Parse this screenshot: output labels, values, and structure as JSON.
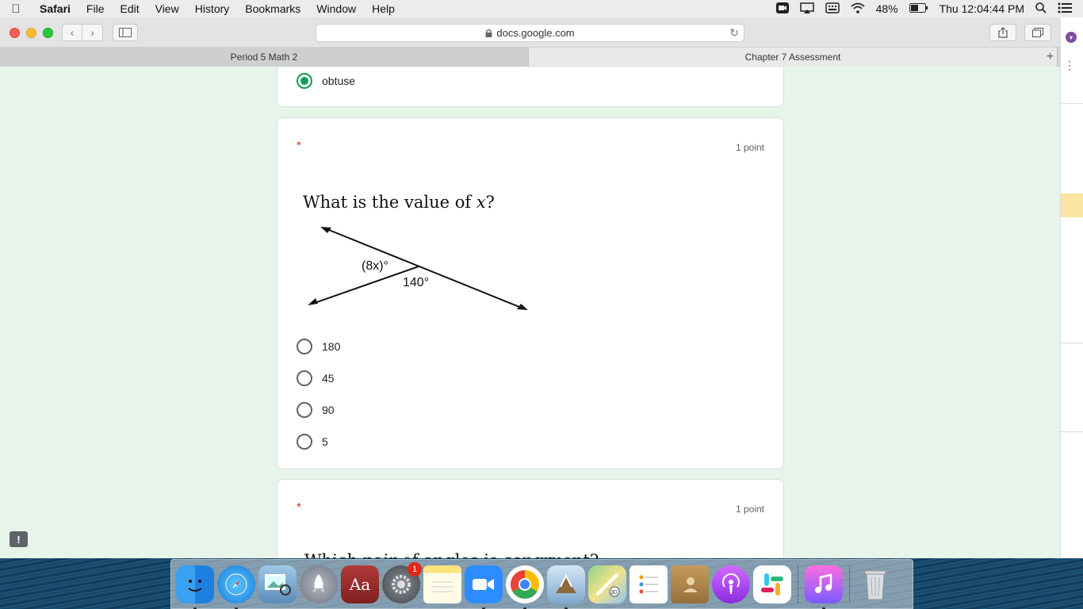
{
  "menubar": {
    "app": "Safari",
    "items": [
      "File",
      "Edit",
      "View",
      "History",
      "Bookmarks",
      "Window",
      "Help"
    ],
    "battery": "48%",
    "clock": "Thu 12:04:44 PM"
  },
  "browser": {
    "url": "docs.google.com",
    "tabs": [
      {
        "label": "Period 5 Math 2"
      },
      {
        "label": "Chapter 7 Assessment"
      }
    ]
  },
  "form": {
    "prev_option": "obtuse",
    "question": {
      "required": "*",
      "points": "1 point",
      "text": "What is the value of",
      "var": "x",
      "qmark": "?",
      "figure": {
        "angle_label_1": "(8x)°",
        "angle_label_2": "140°"
      },
      "options": [
        "180",
        "45",
        "90",
        "5"
      ]
    },
    "next_question": {
      "required": "*",
      "points": "1 point",
      "text_partial": "Which pair of angles is congruent?"
    }
  },
  "dock": {
    "items": [
      "finder",
      "safari",
      "preview",
      "launchpad",
      "dictionary",
      "system-preferences",
      "notes",
      "zoom",
      "chrome",
      "mail",
      "maps",
      "reminders",
      "contacts",
      "podcasts",
      "slack",
      "itunes",
      "trash"
    ],
    "badge_system_preferences": "1",
    "dictionary_label": "Aa"
  },
  "colors": {
    "form_bg": "#e6f4ea",
    "accent_green": "#0f9d58",
    "required_red": "#d93025"
  }
}
